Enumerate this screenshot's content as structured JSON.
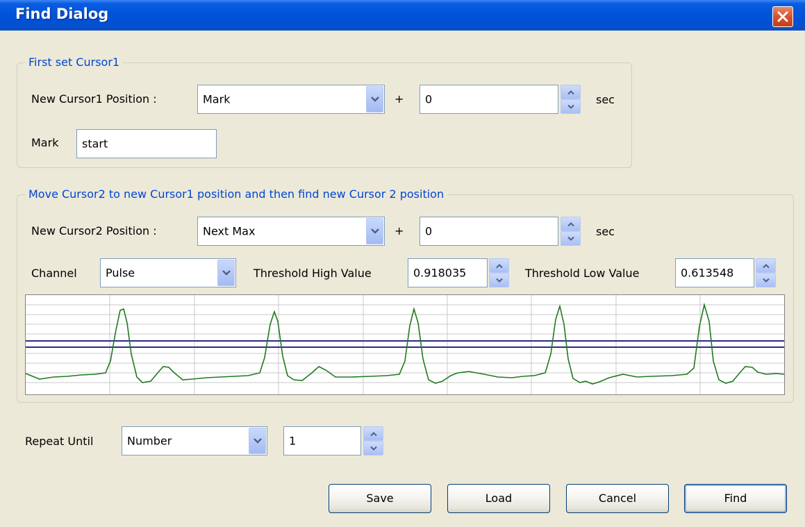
{
  "window": {
    "title": "Find Dialog"
  },
  "cursor1_group": {
    "legend": "First set Cursor1",
    "position_label": "New Cursor1 Position :",
    "position_value": "Mark",
    "plus": "+",
    "offset_value": "0",
    "unit": "sec",
    "mark_label": "Mark",
    "mark_value": "start"
  },
  "cursor2_group": {
    "legend": "Move Cursor2 to new Cursor1 position and then find new Cursor 2 position",
    "position_label": "New Cursor2 Position :",
    "position_value": "Next Max",
    "plus": "+",
    "offset_value": "0",
    "unit": "sec",
    "channel_label": "Channel",
    "channel_value": "Pulse",
    "threshold_high_label": "Threshold High Value",
    "threshold_high_value": "0.918035",
    "threshold_low_label": "Threshold Low Value",
    "threshold_low_value": "0.613548"
  },
  "repeat": {
    "label": "Repeat Until",
    "mode_value": "Number",
    "count_value": "1"
  },
  "buttons": {
    "save": "Save",
    "load": "Load",
    "cancel": "Cancel",
    "find": "Find"
  },
  "colors": {
    "waveform": "#1f7a1f",
    "threshold_lines": "#2a2a8a",
    "legend_text": "#0046d5",
    "titlebar": "#0153d8"
  },
  "icons": {
    "close": "close-icon",
    "dropdown": "chevron-down-icon",
    "spin_up": "spin-up-icon",
    "spin_down": "spin-down-icon"
  }
}
